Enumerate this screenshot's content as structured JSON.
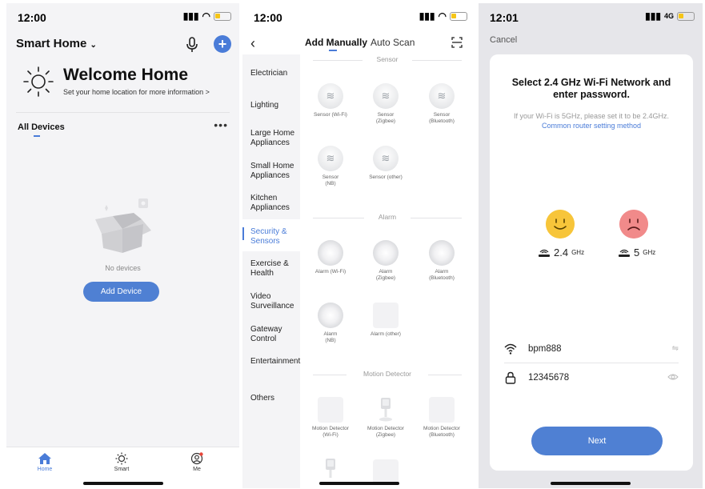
{
  "phone1": {
    "time": "12:00",
    "home_title": "Smart Home",
    "welcome": "Welcome Home",
    "welcome_sub": "Set your home location for more information",
    "all_devices": "All Devices",
    "more": "•••",
    "no_devices": "No devices",
    "add_device": "Add Device",
    "tabs": [
      {
        "label": "Home",
        "icon": "home-icon"
      },
      {
        "label": "Smart",
        "icon": "sun-icon"
      },
      {
        "label": "Me",
        "icon": "profile-icon"
      }
    ]
  },
  "phone2": {
    "time": "12:00",
    "tab_manual": "Add Manually",
    "tab_scan": "Auto Scan",
    "categories": [
      "Electrician",
      "Lighting",
      "Large Home Appliances",
      "Small Home Appliances",
      "Kitchen Appliances",
      "Security & Sensors",
      "Exercise & Health",
      "Video Surveillance",
      "Gateway Control",
      "Entertainment",
      "Others"
    ],
    "sections": {
      "sensor": "Sensor",
      "alarm": "Alarm",
      "motion": "Motion Detector"
    },
    "sensor_items": [
      {
        "name": "Sensor (Wi-Fi)",
        "sub": ""
      },
      {
        "name": "Sensor",
        "sub": "(Zigbee)"
      },
      {
        "name": "Sensor",
        "sub": "(Bluetooth)"
      },
      {
        "name": "Sensor",
        "sub": "(NB)"
      },
      {
        "name": "Sensor (other)",
        "sub": ""
      }
    ],
    "alarm_items": [
      {
        "name": "Alarm (Wi-Fi)",
        "sub": ""
      },
      {
        "name": "Alarm",
        "sub": "(Zigbee)"
      },
      {
        "name": "Alarm",
        "sub": "(Bluetooth)"
      },
      {
        "name": "Alarm",
        "sub": "(NB)"
      },
      {
        "name": "Alarm (other)",
        "sub": ""
      }
    ],
    "motion_items": [
      {
        "name": "Motion Detector",
        "sub": "(Wi-Fi)"
      },
      {
        "name": "Motion Detector",
        "sub": "(Zigbee)"
      },
      {
        "name": "Motion Detector",
        "sub": "(Bluetooth)"
      }
    ]
  },
  "phone3": {
    "time": "12:01",
    "network": "4G",
    "cancel": "Cancel",
    "title": "Select 2.4 GHz Wi-Fi Network and enter password.",
    "hint": "If your Wi-Fi is 5GHz, please set it to be 2.4GHz.",
    "link": "Common router setting method",
    "band_24": "2.4",
    "band_5": "5",
    "band_unit": "GHz",
    "ssid": "bpm888",
    "password": "12345678",
    "next": "Next"
  },
  "colors": {
    "accent": "#4f80d3",
    "happy": "#f7c53a",
    "sad": "#f18a8a"
  }
}
